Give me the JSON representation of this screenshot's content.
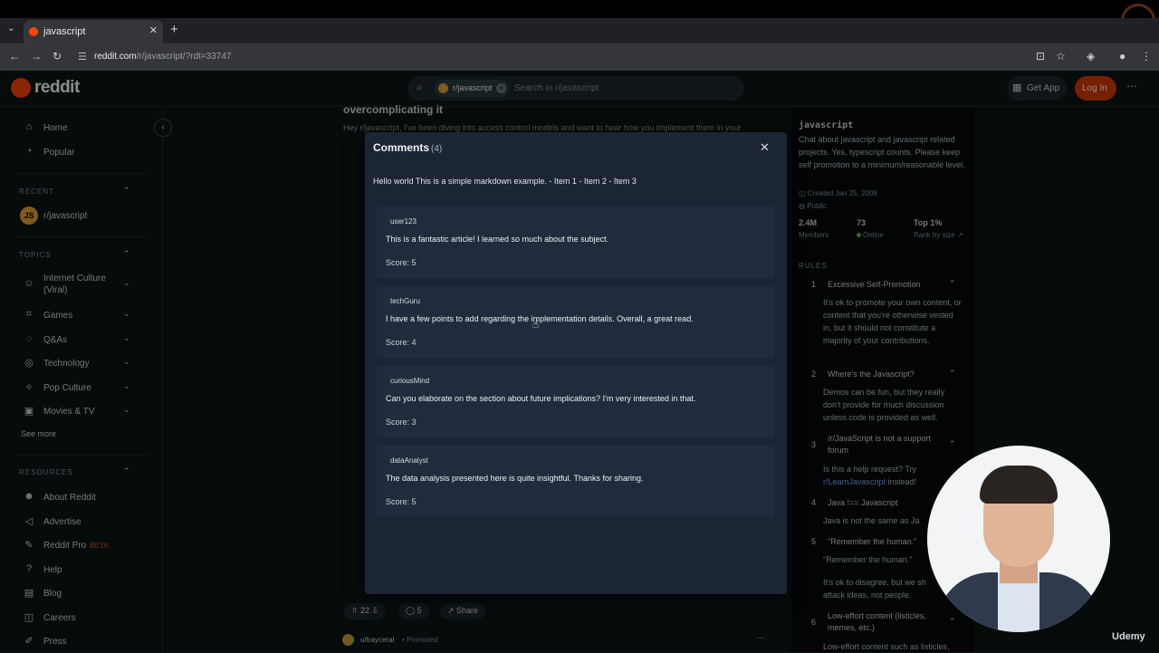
{
  "browser": {
    "tab_title": "javascript",
    "url_host": "reddit.com",
    "url_path": "/r/javascript/?rdt=33747"
  },
  "header": {
    "logo_text": "reddit",
    "search_chip": "r/javascript",
    "search_placeholder": "Search in r/javascript",
    "get_app": "Get App",
    "login": "Log In"
  },
  "sidebar": {
    "home": "Home",
    "popular": "Popular",
    "recent_heading": "RECENT",
    "recent_item": "r/javascript",
    "recent_avatar": "JS",
    "topics_heading": "TOPICS",
    "topics": [
      "Internet Culture (Viral)",
      "Games",
      "Q&As",
      "Technology",
      "Pop Culture",
      "Movies & TV"
    ],
    "see_more": "See more",
    "resources_heading": "RESOURCES",
    "resources": [
      "About Reddit",
      "Advertise",
      "Reddit Pro",
      "Help",
      "Blog",
      "Careers",
      "Press"
    ],
    "beta": "BETA"
  },
  "feed": {
    "post_title": "overcomplicating it",
    "post_snippet": "Hey r/javascript, I've been diving into access control models and want to hear how you implement them in your",
    "upvotes": "22",
    "comments": "5",
    "share": "Share",
    "promo_user": "u/trayceral",
    "promo_tag": "• Promoted"
  },
  "community": {
    "name": "javascript",
    "description": "Chat about javascript and javascript related projects. Yes, typescript counts. Please keep self promotion to a minimum/reasonable level.",
    "created": "Created Jan 25, 2008",
    "visibility": "Public",
    "members_value": "2.4M",
    "members_label": "Members",
    "online_value": "73",
    "online_label": "Online",
    "rank_value": "Top 1%",
    "rank_label": "Rank by size",
    "rules_heading": "RULES",
    "rules": [
      {
        "num": "1",
        "title": "Excessive Self-Promotion",
        "body": "It's ok to promote your own content, or content that you're otherwise vested in, but it should not constitute a majority of your contributions."
      },
      {
        "num": "2",
        "title": "Where's the Javascript?",
        "body": "Demos can be fun, but they really don't provide for much discussion unless code is provided as well."
      },
      {
        "num": "3",
        "title": "/r/JavaScript is not a support forum",
        "body_prefix": "Is this a help request? Try",
        "body_link": "r/LearnJavascript",
        "body_suffix": "instead!"
      },
      {
        "num": "4",
        "title": "Java !== Javascript",
        "body": "Java is not the same as Ja"
      },
      {
        "num": "5",
        "title": "\"Remember the human.\"",
        "body": "\"Remember the human.\"",
        "body2": "It's ok to disagree, but we sh attack ideas, not people."
      },
      {
        "num": "6",
        "title": "Low-effort content (listicles, memes, etc.)",
        "body": "Low-effort content such as listicles,"
      }
    ]
  },
  "modal": {
    "title": "Comments",
    "count": "(4)",
    "markdown": "Hello world This is a simple markdown example. - Item 1 - Item 2 - Item 3",
    "comments": [
      {
        "user": "user123",
        "body": "This is a fantastic article! I learned so much about the subject.",
        "score": "Score: 5"
      },
      {
        "user": "techGuru",
        "body": "I have a few points to add regarding the implementation details. Overall, a great read.",
        "score": "Score: 4"
      },
      {
        "user": "curiousMind",
        "body": "Can you elaborate on the section about future implications? I'm very interested in that.",
        "score": "Score: 3"
      },
      {
        "user": "dataAnalyst",
        "body": "The data analysis presented here is quite insightful. Thanks for sharing.",
        "score": "Score: 5"
      }
    ]
  },
  "watermark": "Udemy",
  "colors": {
    "accent": "#ff4500",
    "modal_bg": "#1b2535",
    "comment_bg": "#202c3d",
    "page_bg": "#0b1416"
  }
}
